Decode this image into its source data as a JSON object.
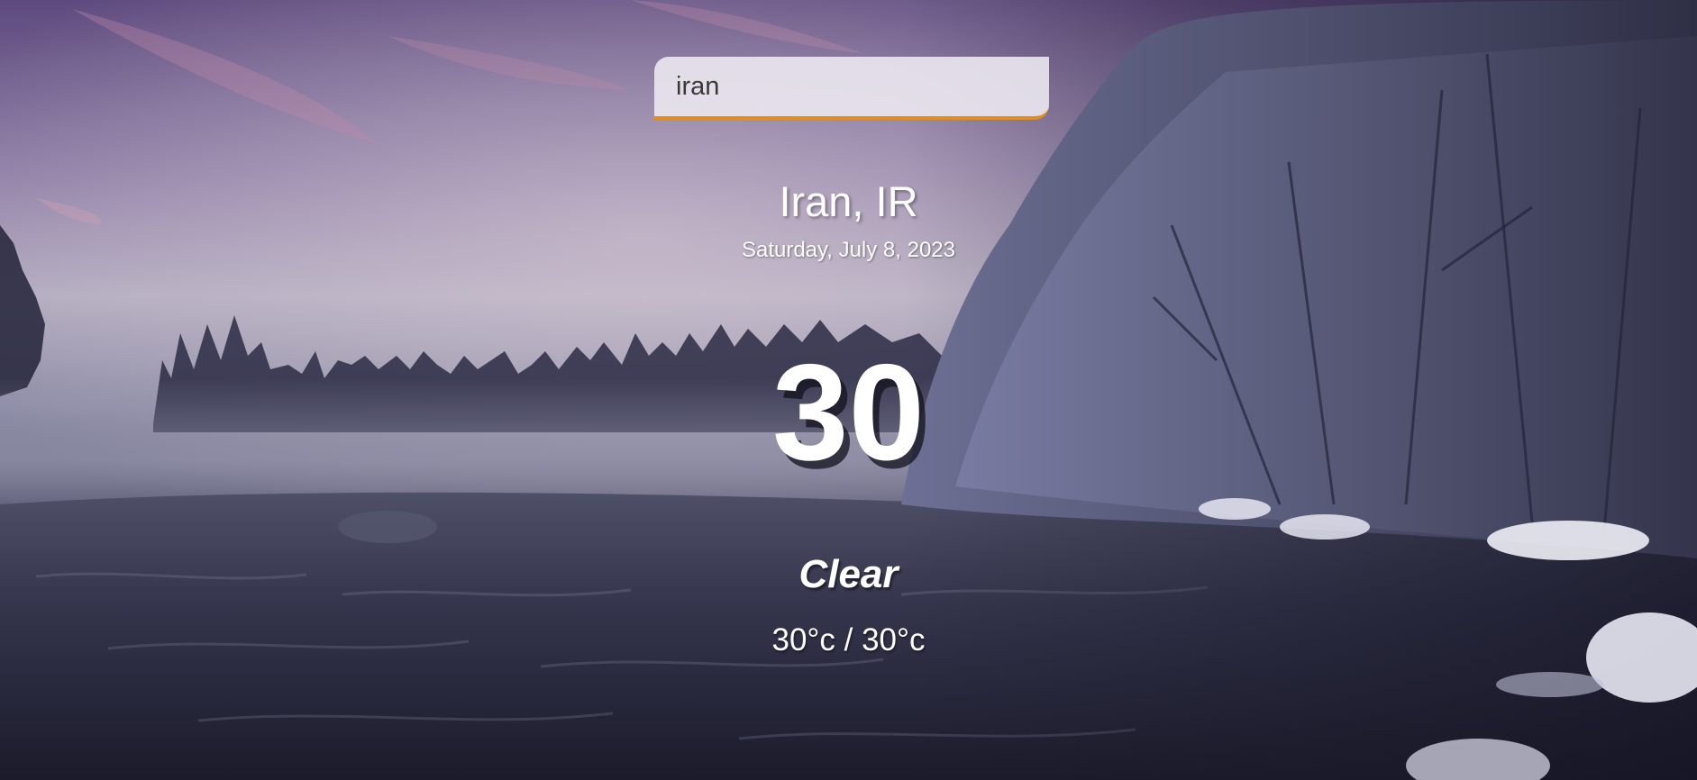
{
  "search": {
    "value": "iran"
  },
  "location": {
    "city": "Iran, IR",
    "date": "Saturday, July 8, 2023"
  },
  "current": {
    "temperature": "30",
    "condition": "Clear",
    "hi_low": "30°c / 30°c"
  },
  "colors": {
    "search_underline": "#df8e1f",
    "text": "#ffffff"
  }
}
